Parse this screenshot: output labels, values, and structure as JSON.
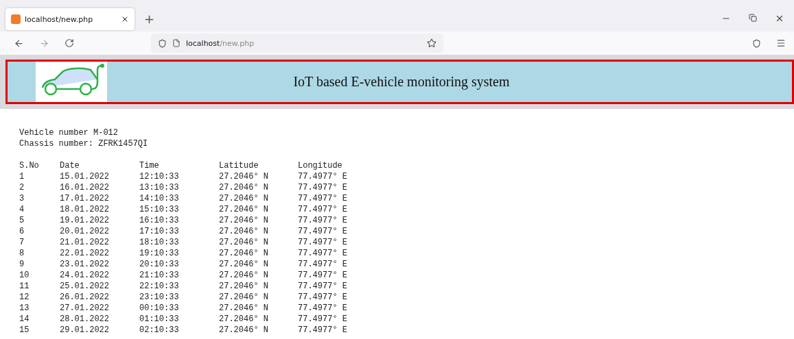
{
  "browser": {
    "tab": {
      "title": "localhost/new.php",
      "selected": true
    },
    "new_tab": "+",
    "address": {
      "host": "localhost",
      "path": "/new.php"
    }
  },
  "banner": {
    "title": "IoT based E-vehicle monitoring system"
  },
  "vehicle": [
    "Vehicle number M-012",
    "Chassis number: ZFRK1457QI"
  ],
  "table": {
    "columns": [
      "S.No",
      "Date",
      "Time",
      "Latitude",
      "Longitude"
    ],
    "rows": [
      [
        "1",
        "15.01.2022",
        "12:10:33",
        "27.2046° N",
        "77.4977° E"
      ],
      [
        "2",
        "16.01.2022",
        "13:10:33",
        "27.2046° N",
        "77.4977° E"
      ],
      [
        "3",
        "17.01.2022",
        "14:10:33",
        "27.2046° N",
        "77.4977° E"
      ],
      [
        "4",
        "18.01.2022",
        "15:10:33",
        "27.2046° N",
        "77.4977° E"
      ],
      [
        "5",
        "19.01.2022",
        "16:10:33",
        "27.2046° N",
        "77.4977° E"
      ],
      [
        "6",
        "20.01.2022",
        "17:10:33",
        "27.2046° N",
        "77.4977° E"
      ],
      [
        "7",
        "21.01.2022",
        "18:10:33",
        "27.2046° N",
        "77.4977° E"
      ],
      [
        "8",
        "22.01.2022",
        "19:10:33",
        "27.2046° N",
        "77.4977° E"
      ],
      [
        "9",
        "23.01.2022",
        "20:10:33",
        "27.2046° N",
        "77.4977° E"
      ],
      [
        "10",
        "24.01.2022",
        "21:10:33",
        "27.2046° N",
        "77.4977° E"
      ],
      [
        "11",
        "25.01.2022",
        "22:10:33",
        "27.2046° N",
        "77.4977° E"
      ],
      [
        "12",
        "26.01.2022",
        "23:10:33",
        "27.2046° N",
        "77.4977° E"
      ],
      [
        "13",
        "27.01.2022",
        "00:10:33",
        "27.2046° N",
        "77.4977° E"
      ],
      [
        "14",
        "28.01.2022",
        "01:10:33",
        "27.2046° N",
        "77.4977° E"
      ],
      [
        "15",
        "29.01.2022",
        "02:10:33",
        "27.2046° N",
        "77.4977° E"
      ]
    ]
  }
}
